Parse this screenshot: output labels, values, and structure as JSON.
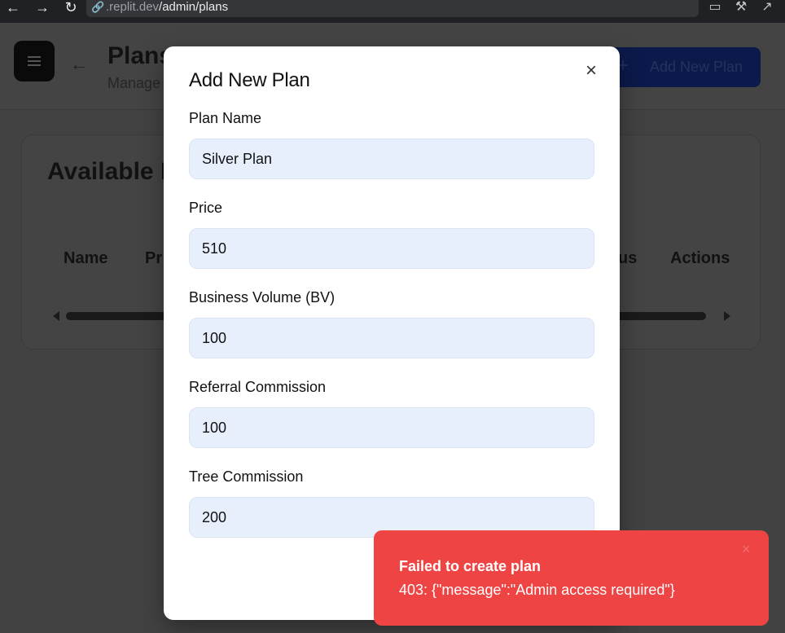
{
  "browser": {
    "url_prefix": ".replit.dev",
    "url_path": "/admin/plans",
    "icons": [
      "back-arrow-icon",
      "forward-arrow-icon",
      "reload-icon",
      "link-icon",
      "cast-icon",
      "wrench-icon",
      "open-external-icon"
    ]
  },
  "header": {
    "title": "Plans",
    "subtitle": "Manage",
    "add_button_label": "Add New Plan"
  },
  "card": {
    "title": "Available P",
    "columns": [
      "Name",
      "Pr",
      "us",
      "Actions"
    ]
  },
  "modal": {
    "title": "Add New Plan",
    "close_symbol": "×",
    "fields": [
      {
        "label": "Plan Name",
        "value": "Silver Plan"
      },
      {
        "label": "Price",
        "value": "510"
      },
      {
        "label": "Business Volume (BV)",
        "value": "100"
      },
      {
        "label": "Referral Commission",
        "value": "100"
      },
      {
        "label": "Tree Commission",
        "value": "200"
      }
    ]
  },
  "toast": {
    "title": "Failed to create plan",
    "message": "403: {\"message\":\"Admin access required\"}",
    "color": "#ef4444"
  },
  "colors": {
    "accent_dark": "#0c1a4b",
    "input_bg": "#e8effc",
    "overlay": "#424242"
  }
}
